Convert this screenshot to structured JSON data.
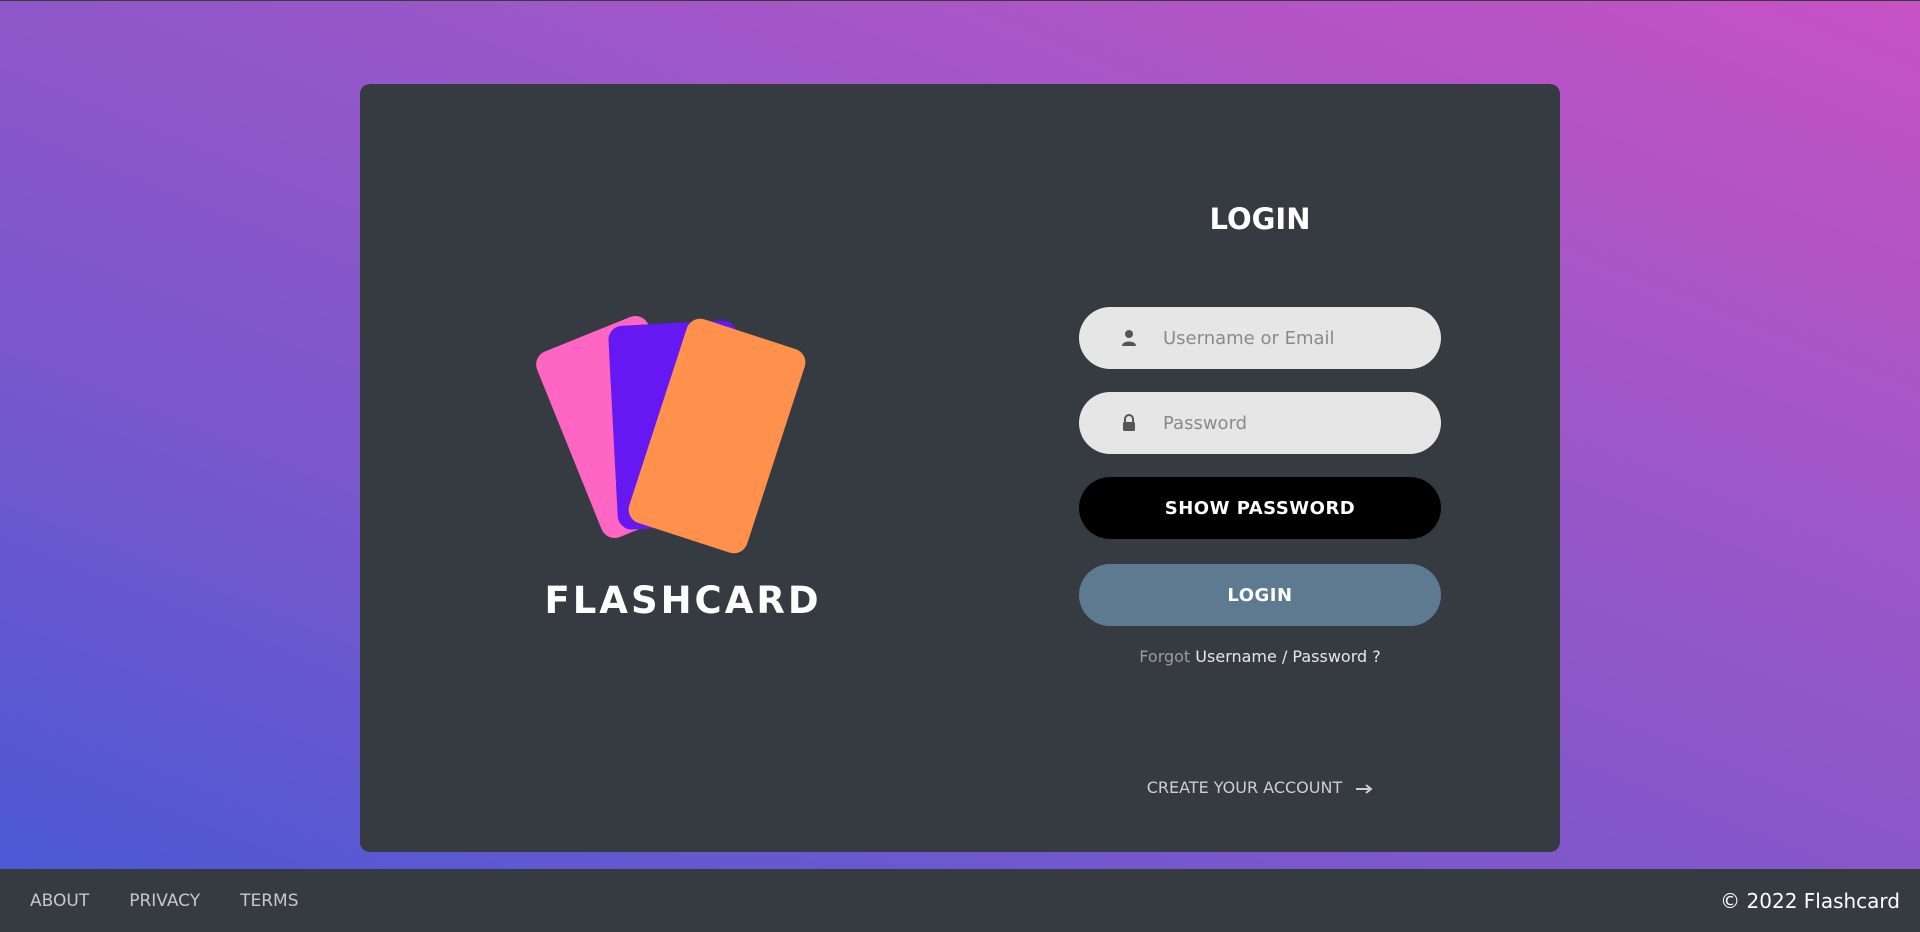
{
  "brand": {
    "name": "FLASHCARD",
    "colors": {
      "pink": "#ff66c4",
      "purple": "#6618f2",
      "orange": "#ff914d"
    }
  },
  "login_form": {
    "title": "LOGIN",
    "username_placeholder": "Username or Email",
    "username_icon": "user-icon",
    "password_placeholder": "Password",
    "password_icon": "lock-icon",
    "show_password_label": "SHOW PASSWORD",
    "login_label": "LOGIN",
    "forgot_prefix": "Forgot",
    "forgot_link": "Username / Password ?",
    "create_account_label": "CREATE YOUR ACCOUNT",
    "create_account_icon": "arrow-right-icon"
  },
  "footer": {
    "links": [
      {
        "label": "ABOUT"
      },
      {
        "label": "PRIVACY"
      },
      {
        "label": "TERMS"
      }
    ],
    "copyright": "© 2022 Flashcard"
  },
  "colors": {
    "card_bg": "#363a41",
    "show_button_bg": "#000000",
    "login_button_bg": "#5d7a91",
    "input_bg": "#e6e6e6"
  }
}
